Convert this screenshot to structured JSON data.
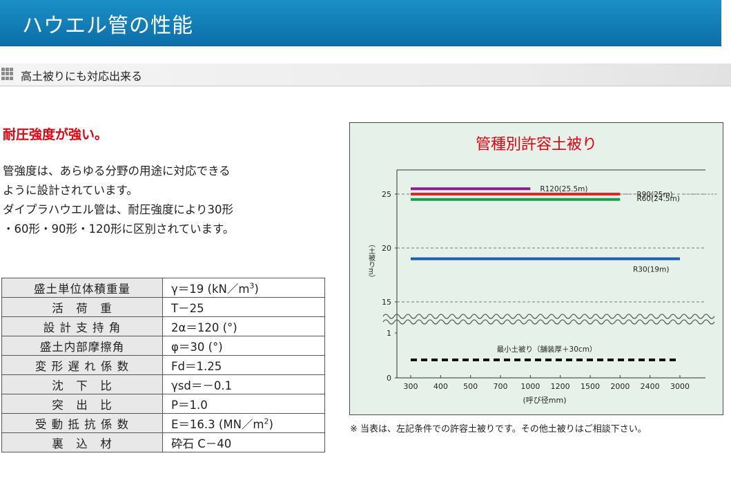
{
  "header": {
    "title": "ハウエル管の性能"
  },
  "section": {
    "icon": "grid-icon",
    "label": "高土被りにも対応出来る"
  },
  "intro": {
    "heading": "耐圧強度が強い。",
    "lines": [
      "管強度は、あらゆる分野の用途に対応できる",
      "ように設計されています。",
      "ダイプラハウエル管は、耐圧強度により30形",
      "・60形・90形・120形に区別されています。"
    ]
  },
  "table": {
    "rows": [
      {
        "key": "盛土単位体積重量",
        "value_pre": "γ＝19 (kN／m",
        "sup": "3",
        "value_post": ")"
      },
      {
        "key": "活　荷　重",
        "value_pre": "T－25",
        "sup": "",
        "value_post": ""
      },
      {
        "key": "設 計 支 持 角",
        "value_pre": "2α＝120 (°)",
        "sup": "",
        "value_post": ""
      },
      {
        "key": "盛土内部摩擦角",
        "value_pre": "φ＝30 (°)",
        "sup": "",
        "value_post": ""
      },
      {
        "key": "変 形 遅 れ 係 数",
        "value_pre": "Fd＝1.25",
        "sup": "",
        "value_post": ""
      },
      {
        "key": "沈　下　比",
        "value_pre": "γsd＝－0.1",
        "sup": "",
        "value_post": ""
      },
      {
        "key": "突　出　比",
        "value_pre": "P＝1.0",
        "sup": "",
        "value_post": ""
      },
      {
        "key": "受 動 抵 抗 係 数",
        "value_pre": "E＝16.3 (MN／m",
        "sup": "2",
        "value_post": ")"
      },
      {
        "key": "裏　込　材",
        "value_pre": "砕石 C－40",
        "sup": "",
        "value_post": ""
      }
    ]
  },
  "chart_data": {
    "type": "line",
    "title": "管種別許容土被り",
    "ylabel": "（土被りm）",
    "xlabel": "(呼び径mm)",
    "categories": [
      "300",
      "400",
      "500",
      "700",
      "1000",
      "1200",
      "1500",
      "2000",
      "2400",
      "3000"
    ],
    "y_ticks": [
      "0",
      "1",
      "15",
      "20",
      "25"
    ],
    "axis_break": "between 1 and 15",
    "series": [
      {
        "label": "R120(25.5m)",
        "value": 25.5,
        "x_from": "300",
        "x_to": "1000",
        "color": "#8e1e8e",
        "dashed": false
      },
      {
        "label": "R90(25m)",
        "value": 25,
        "x_from": "300",
        "x_to": "2000",
        "color": "#e0262b",
        "dashed": false
      },
      {
        "label": "R60(24.5m)",
        "value": 24.5,
        "x_from": "300",
        "x_to": "2000",
        "color": "#16a04a",
        "dashed": false
      },
      {
        "label": "R30(19m)",
        "value": 19,
        "x_from": "300",
        "x_to": "3000",
        "color": "#1a5fb4",
        "dashed": false
      },
      {
        "label": "最小土被り（舗装厚＋30cm）",
        "value": 0.4,
        "x_from": "300",
        "x_to": "3000",
        "color": "#111111",
        "dashed": true
      }
    ],
    "grid": "dashed horizontal lines at 15, 20, 25"
  },
  "note": "※ 当表は、左記条件での許容土被りです。その他土被りはご相談下さい。"
}
